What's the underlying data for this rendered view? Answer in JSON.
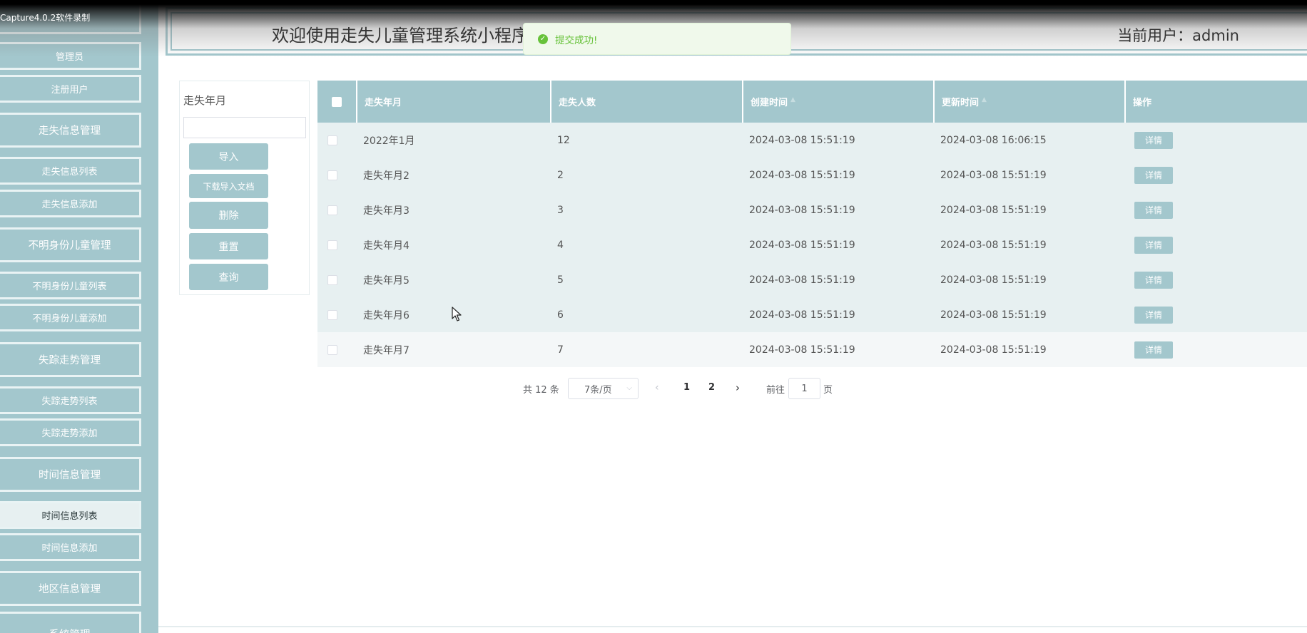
{
  "watermark": "Capture4.0.2软件录制",
  "header": {
    "title": "欢迎使用走失儿童管理系统小程序",
    "current_user": "当前用户：admin"
  },
  "toast": {
    "text": "提交成功!",
    "icon": "check-circle-icon",
    "color": "#67c23a"
  },
  "colors": {
    "accent": "#a3c7cd",
    "row_bg": "#e7f0f1",
    "row_bg_light": "#f4f7f8"
  },
  "sidebar": {
    "items": [
      {
        "label": "",
        "type": "group"
      },
      {
        "label": "管理员",
        "type": "item"
      },
      {
        "label": "注册用户",
        "type": "item"
      },
      {
        "label": "走失信息管理",
        "type": "group"
      },
      {
        "label": "走失信息列表",
        "type": "item"
      },
      {
        "label": "走失信息添加",
        "type": "item"
      },
      {
        "label": "不明身份儿童管理",
        "type": "group"
      },
      {
        "label": "不明身份儿童列表",
        "type": "item"
      },
      {
        "label": "不明身份儿童添加",
        "type": "item"
      },
      {
        "label": "失踪走势管理",
        "type": "group"
      },
      {
        "label": "失踪走势列表",
        "type": "item"
      },
      {
        "label": "失踪走势添加",
        "type": "item"
      },
      {
        "label": "时间信息管理",
        "type": "group"
      },
      {
        "label": "时间信息列表",
        "type": "item",
        "active": true
      },
      {
        "label": "时间信息添加",
        "type": "item"
      },
      {
        "label": "地区信息管理",
        "type": "group"
      },
      {
        "label": "系统管理",
        "type": "group"
      }
    ]
  },
  "search": {
    "label": "走失年月",
    "value": "",
    "buttons": {
      "import": "导入",
      "download": "下载导入文档",
      "delete": "删除",
      "reset": "重置",
      "query": "查询"
    }
  },
  "table": {
    "headers": {
      "month": "走失年月",
      "count": "走失人数",
      "created": "创建时间",
      "updated": "更新时间",
      "actions": "操作"
    },
    "detail_label": "详情",
    "rows": [
      {
        "month": "2022年1月",
        "count": "12",
        "created": "2024-03-08 15:51:19",
        "updated": "2024-03-08 16:06:15"
      },
      {
        "month": "走失年月2",
        "count": "2",
        "created": "2024-03-08 15:51:19",
        "updated": "2024-03-08 15:51:19"
      },
      {
        "month": "走失年月3",
        "count": "3",
        "created": "2024-03-08 15:51:19",
        "updated": "2024-03-08 15:51:19"
      },
      {
        "month": "走失年月4",
        "count": "4",
        "created": "2024-03-08 15:51:19",
        "updated": "2024-03-08 15:51:19"
      },
      {
        "month": "走失年月5",
        "count": "5",
        "created": "2024-03-08 15:51:19",
        "updated": "2024-03-08 15:51:19"
      },
      {
        "month": "走失年月6",
        "count": "6",
        "created": "2024-03-08 15:51:19",
        "updated": "2024-03-08 15:51:19"
      },
      {
        "month": "走失年月7",
        "count": "7",
        "created": "2024-03-08 15:51:19",
        "updated": "2024-03-08 15:51:19"
      }
    ]
  },
  "pagination": {
    "total": "共 12 条",
    "page_size": "7条/页",
    "pages": [
      "1",
      "2"
    ],
    "current_page": "1",
    "goto_label": "前往",
    "goto_value": "1",
    "page_suffix": "页"
  }
}
